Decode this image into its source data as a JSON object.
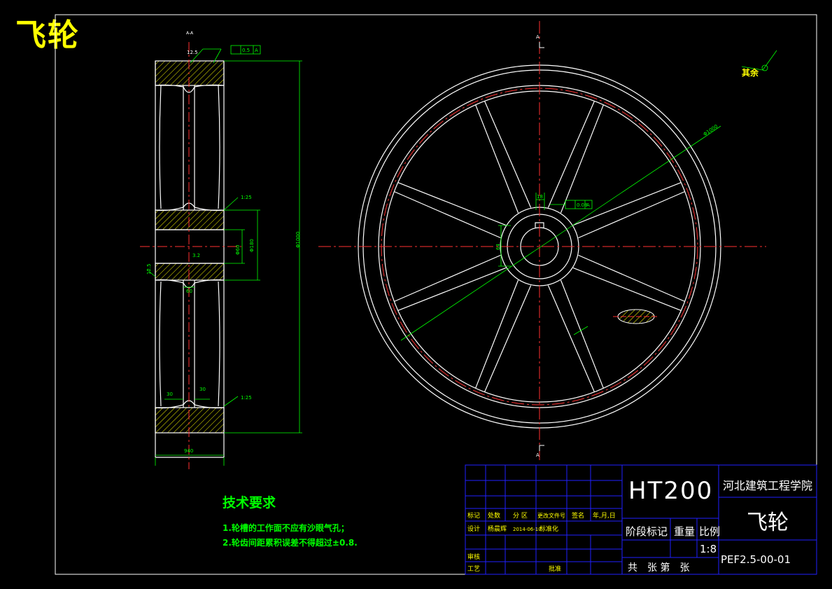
{
  "drawing_title": "飞轮",
  "section_label": "A-A",
  "rest_roughness": "其余",
  "technical_requirements": {
    "heading": "技术要求",
    "items": [
      "1.轮槽的工作面不应有沙眼气孔；",
      "2.轮齿间距累积误差不得超过±0.8."
    ]
  },
  "dimensions": {
    "outer_dia": "Φ1000",
    "dia_side": "Φ1000",
    "width": "940",
    "hub_dia": "Φ180",
    "bore": "Φ60",
    "keyway": "18",
    "key_depth": "64",
    "hub_len": "60",
    "slope_top": "1:25",
    "slope_bottom": "1:25",
    "roughness_top": "12.5",
    "roughness_side": "12.5",
    "roughness_bore": "3.2",
    "tol_top": "0.5",
    "tol_top_ref": "A",
    "tol_right": "0.08",
    "tol_right_ref": "A",
    "web_small_1": "30",
    "web_small_2": "30",
    "section_mark": "A"
  },
  "title_block": {
    "material": "HT200",
    "school": "河北建筑工程学院",
    "part_name": "飞轮",
    "drawing_no": "PEF2.5-00-01",
    "scale_label": "比例",
    "scale_value": "1:8",
    "stage_label": "阶段标记",
    "weight_label": "重量",
    "sheets_label": "共　张 第　张",
    "header_row": [
      "标记",
      "处数",
      "分 区",
      "更改文件号",
      "签名",
      "年,月,日"
    ],
    "design_label": "设计",
    "designer": "杨晨辉",
    "design_date": "2014-06-10",
    "standardization": "标准化",
    "review_label": "审核",
    "process_label": "工艺",
    "approve_label": "批准"
  },
  "colors": {
    "background": "#000000",
    "outline": "#ffffff",
    "dimension": "#00ff00",
    "center_line": "#ff0000",
    "title_block": "#2020ff",
    "hatch": "#ffff00"
  }
}
